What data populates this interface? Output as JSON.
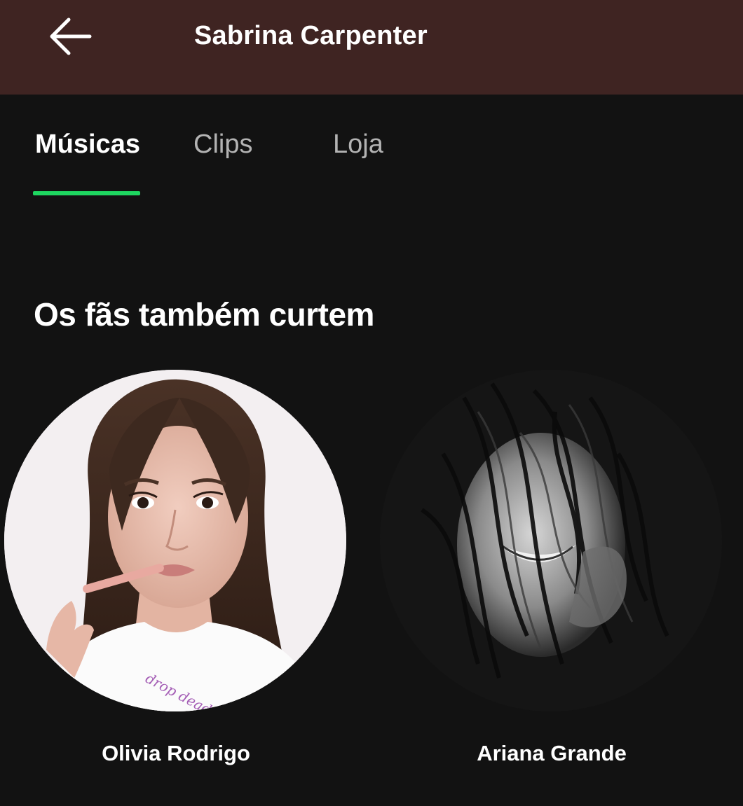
{
  "header": {
    "title": "Sabrina Carpenter",
    "back_icon": "arrow-left-icon"
  },
  "tabs": [
    {
      "label": "Músicas",
      "active": true
    },
    {
      "label": "Clips",
      "active": false
    },
    {
      "label": "Loja",
      "active": false
    }
  ],
  "section": {
    "title": "Os fãs também curtem"
  },
  "artists": [
    {
      "name": "Olivia Rodrigo",
      "shirt_text": "drop dead"
    },
    {
      "name": "Ariana Grande"
    }
  ],
  "colors": {
    "header_bg": "#3f2422",
    "page_bg": "#121212",
    "accent": "#1ed760",
    "text_primary": "#ffffff",
    "text_secondary": "#b3b3b3"
  }
}
